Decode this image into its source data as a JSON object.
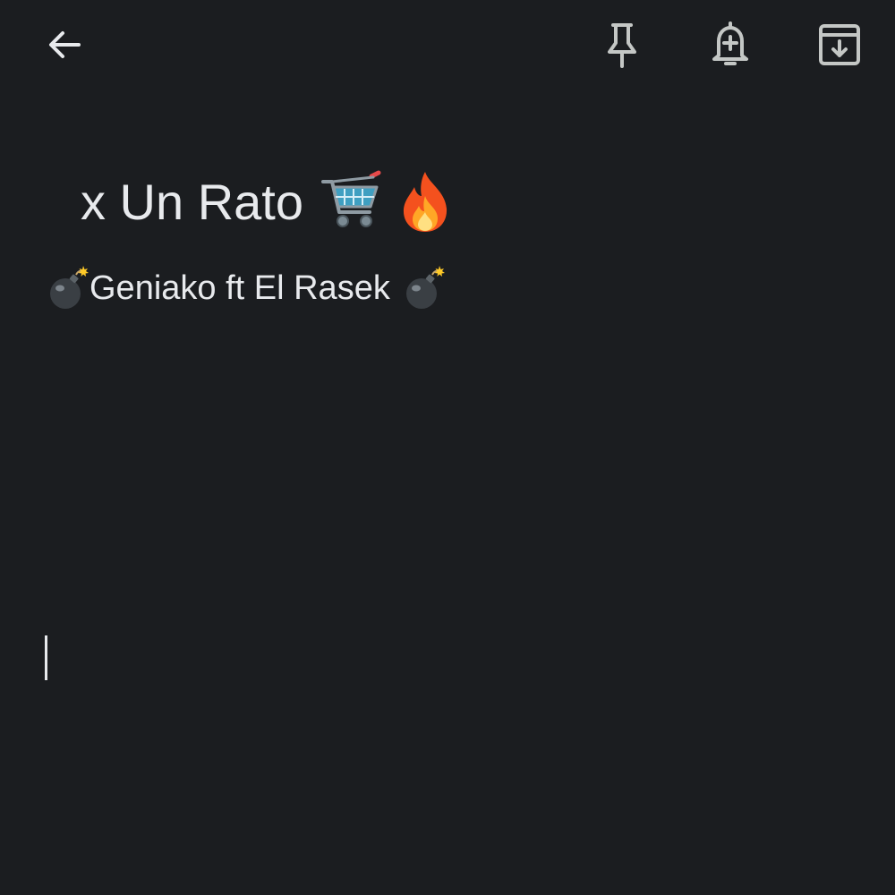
{
  "toolbar": {
    "back_icon": "arrow-back-icon",
    "pin_icon": "pin-icon",
    "reminder_icon": "add-reminder-bell-icon",
    "archive_icon": "archive-icon"
  },
  "note": {
    "title": "x Un Rato",
    "title_emojis": [
      "shopping-cart-icon",
      "fire-icon"
    ],
    "body": "Geniako ft El Rasek",
    "body_emojis": [
      "bomb-icon",
      "bomb-icon"
    ]
  },
  "colors": {
    "background": "#1b1d20",
    "text": "#e8eaed",
    "icon": "#c4c7c5"
  }
}
